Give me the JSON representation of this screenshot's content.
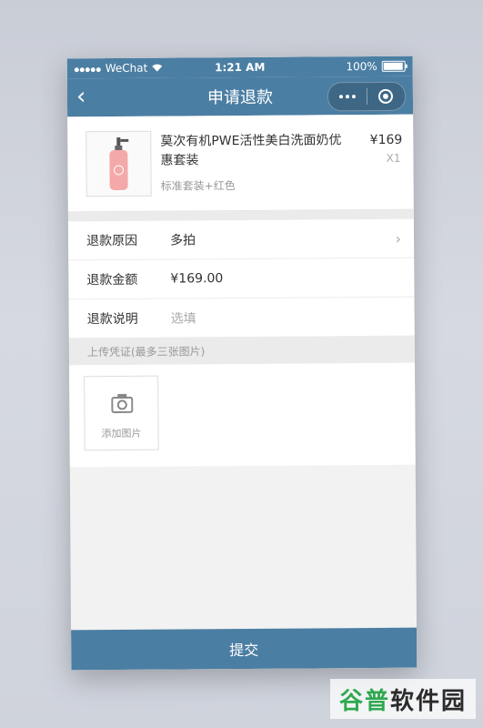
{
  "status_bar": {
    "carrier": "WeChat",
    "time": "1:21 AM",
    "battery": "100%"
  },
  "navbar": {
    "back_icon": "‹",
    "title": "申请退款"
  },
  "product": {
    "name": "莫次有机PWE活性美白洗面奶优惠套装",
    "spec": "标准套装+红色",
    "price": "¥169",
    "quantity": "X1"
  },
  "form": {
    "reason_label": "退款原因",
    "reason_value": "多拍",
    "amount_label": "退款金额",
    "amount_value": "¥169.00",
    "desc_label": "退款说明",
    "desc_placeholder": "选填"
  },
  "upload": {
    "header": "上传凭证(最多三张图片)",
    "add_label": "添加图片"
  },
  "submit_label": "提交",
  "watermark": {
    "part1": "谷普",
    "part2": "软件园"
  },
  "colors": {
    "accent": "#4b7ea3",
    "background": "#f2f2f2"
  }
}
